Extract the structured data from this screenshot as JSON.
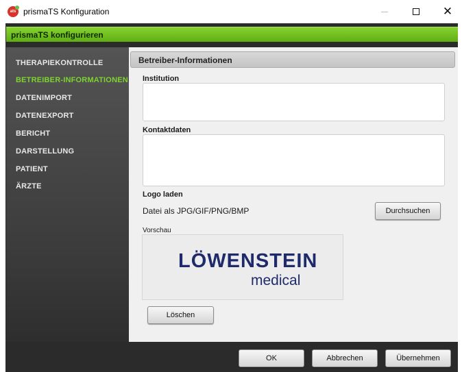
{
  "window": {
    "title": "prismaTS Konfiguration",
    "app_icon_text": "ats",
    "close_glyph": "✕"
  },
  "header": {
    "title": "prismaTS konfigurieren"
  },
  "sidebar": {
    "items": [
      {
        "label": "THERAPIEKONTROLLE",
        "active": false
      },
      {
        "label": "BETREIBER-INFORMATIONEN",
        "active": true
      },
      {
        "label": "DATENIMPORT",
        "active": false
      },
      {
        "label": "DATENEXPORT",
        "active": false
      },
      {
        "label": "BERICHT",
        "active": false
      },
      {
        "label": "DARSTELLUNG",
        "active": false
      },
      {
        "label": "PATIENT",
        "active": false
      },
      {
        "label": "ÄRZTE",
        "active": false
      }
    ]
  },
  "main": {
    "section_title": "Betreiber-Informationen",
    "institution": {
      "label": "Institution",
      "value": ""
    },
    "contact": {
      "label": "Kontaktdaten",
      "value": ""
    },
    "logo": {
      "label": "Logo laden",
      "file_types": "Datei als JPG/GIF/PNG/BMP",
      "browse_label": "Durchsuchen",
      "preview_label": "Vorschau",
      "logo_line1": "LÖWENSTEIN",
      "logo_line2": "medical",
      "delete_label": "Löschen"
    }
  },
  "footer": {
    "ok_label": "OK",
    "cancel_label": "Abbrechen",
    "apply_label": "Übernehmen"
  },
  "colors": {
    "accent_green": "#7ed331",
    "header_green": "#5fae14",
    "logo_navy": "#1f2a6b",
    "sidebar_dark": "#3b3b3b"
  }
}
